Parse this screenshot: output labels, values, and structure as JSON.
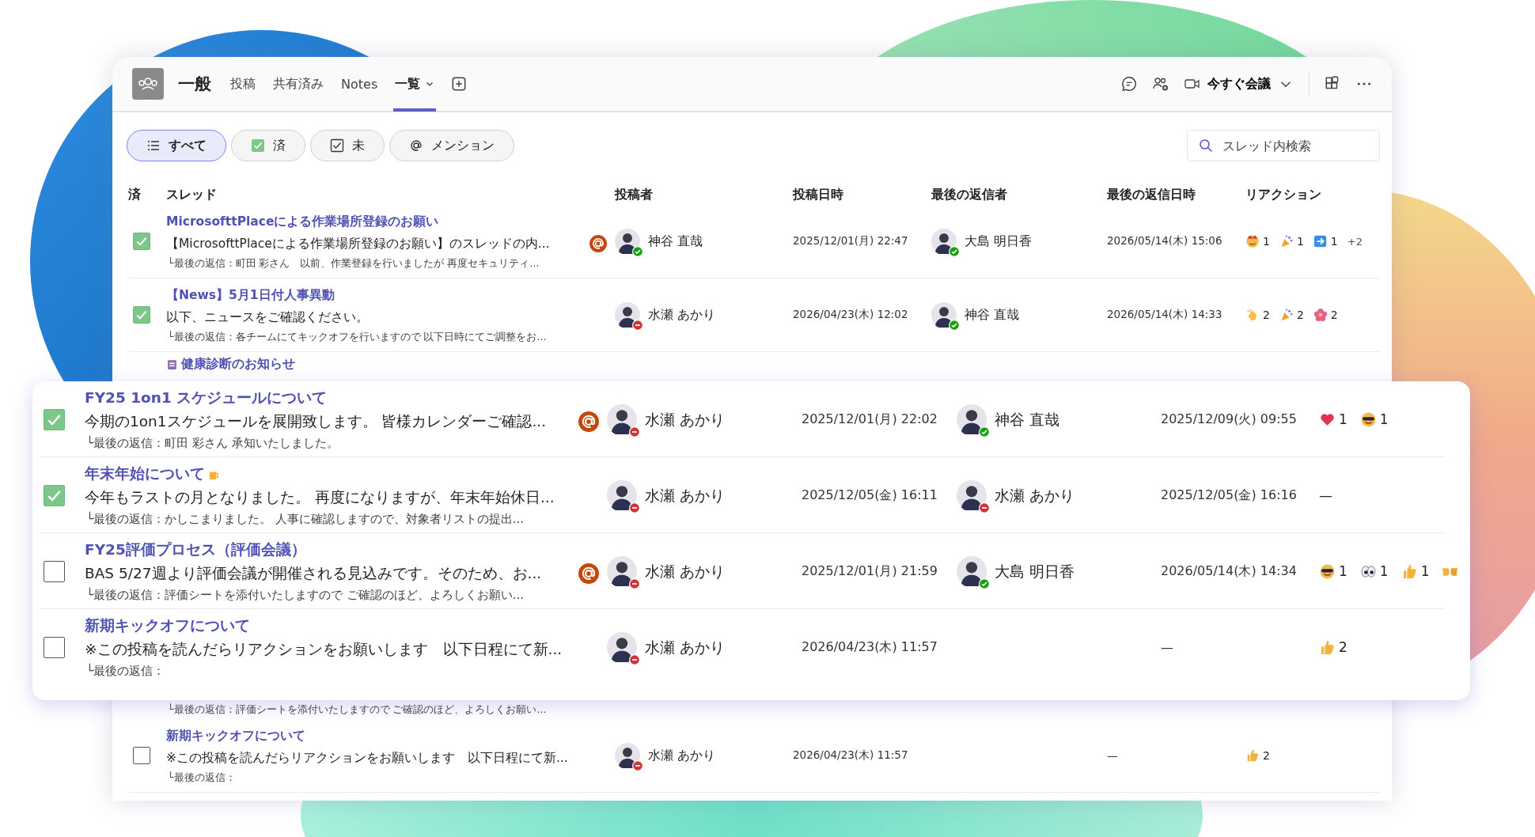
{
  "channel": {
    "name": "一般",
    "tabs": [
      {
        "label": "投稿",
        "selected": false,
        "dropdown": false
      },
      {
        "label": "共有済み",
        "selected": false,
        "dropdown": false
      },
      {
        "label": "Notes",
        "selected": false,
        "dropdown": false
      },
      {
        "label": "一覧",
        "selected": true,
        "dropdown": true
      }
    ]
  },
  "toolbar": {
    "meet_label": "今すぐ会議"
  },
  "filters": [
    {
      "kind": "all",
      "label": "すべて",
      "selected": true
    },
    {
      "kind": "done",
      "label": "済",
      "selected": false
    },
    {
      "kind": "todo",
      "label": "未",
      "selected": false
    },
    {
      "kind": "mention",
      "label": "メンション",
      "selected": false
    }
  ],
  "search": {
    "placeholder": "スレッド内検索"
  },
  "table": {
    "columns": [
      "済",
      "スレッド",
      "投稿者",
      "投稿日時",
      "最後の返信者",
      "最後の返信日時",
      "リアクション"
    ],
    "rows": [
      {
        "done": true,
        "title": "MicrosofttPlaceによる作業場所登録のお願い",
        "preview": "【MicrosofttPlaceによる作業場所登録のお願い】のスレッドの内...",
        "mention": true,
        "reply": "└最後の返信：町田 彩さん　以前、作業登録を行いましたが 再度セキュリティ...",
        "poster": {
          "name": "神谷 直哉",
          "online": true
        },
        "posted": "2025/12/01(月) 22:47",
        "last_replier": {
          "name": "大島 明日香",
          "online": true
        },
        "last_replied": "2026/05/14(木) 15:06",
        "reactions": [
          {
            "kind": "face",
            "count": "1"
          },
          {
            "kind": "party",
            "count": "1"
          },
          {
            "kind": "arrow",
            "count": "1"
          }
        ],
        "more": "+2"
      },
      {
        "done": true,
        "title": "【News】5月1日付人事異動",
        "preview": "以下、ニュースをご確認ください。",
        "mention": false,
        "reply": "└最後の返信：各チームにてキックオフを行いますので 以下日時にてご調整をお...",
        "poster": {
          "name": "水瀬 あかり",
          "online": false
        },
        "posted": "2026/04/23(木) 12:02",
        "last_replier": {
          "name": "神谷 直哉",
          "online": true
        },
        "last_replied": "2026/05/14(木) 14:33",
        "reactions": [
          {
            "kind": "clap",
            "count": "2"
          },
          {
            "kind": "party",
            "count": "2"
          },
          {
            "kind": "flower",
            "count": "2"
          }
        ]
      },
      {
        "title": "健康診断のお知らせ",
        "title_icon": {
          "kind": "clipboard"
        }
      },
      {
        "reply": "└最後の返信：評価シートを添付いたしますので ご確認のほど、よろしくお願い..."
      },
      {
        "done": false,
        "title": "新期キックオフについて",
        "preview": "※この投稿を読んだらリアクションをお願いします　以下日程にて新...",
        "mention": false,
        "reply": "└最後の返信：",
        "poster": {
          "name": "水瀬 あかり",
          "online": false
        },
        "posted": "2026/04/23(木) 11:57",
        "last_replied": "—",
        "reactions": [
          {
            "kind": "thumbs",
            "count": "2"
          }
        ]
      }
    ]
  },
  "zoomed_card": {
    "rows": [
      {
        "done": true,
        "title": "FY25 1on1 スケジュールについて",
        "preview": "今期の1on1スケジュールを展開致します。 皆様カレンダーご確認...",
        "mention": true,
        "reply": "└最後の返信：町田 彩さん 承知いたしました。",
        "poster": {
          "name": "水瀬 あかり",
          "online": false
        },
        "posted": "2025/12/01(月) 22:02",
        "last_replier": {
          "name": "神谷 直哉",
          "online": true
        },
        "last_replied": "2025/12/09(火) 09:55",
        "reactions": [
          {
            "kind": "heart",
            "count": "1"
          },
          {
            "kind": "cool",
            "count": "1"
          }
        ]
      },
      {
        "done": true,
        "title": "年末年始について",
        "title_icon": {
          "kind": "beer"
        },
        "preview": "今年もラストの月となりました。 再度になりますが、年末年始休日...",
        "mention": false,
        "reply": "└最後の返信：かしこまりました。 人事に確認しますので、対象者リストの提出...",
        "poster": {
          "name": "水瀬 あかり",
          "online": false
        },
        "posted": "2025/12/05(金) 16:11",
        "last_replier": {
          "name": "水瀬 あかり",
          "online": false
        },
        "last_replied": "2025/12/05(金) 16:16",
        "reaction_note": "—"
      },
      {
        "done": false,
        "title": "FY25評価プロセス（評価会議）",
        "preview": "BAS 5/27週より評価会議が開催される見込みです。そのため、お...",
        "mention": true,
        "reply": "└最後の返信：評価シートを添付いたしますので ご確認のほど、よろしくお願い...",
        "poster": {
          "name": "水瀬 あかり",
          "online": false
        },
        "posted": "2025/12/01(月) 21:59",
        "last_replier": {
          "name": "大島 明日香",
          "online": true
        },
        "last_replied": "2026/05/14(木) 14:34",
        "reactions": [
          {
            "kind": "cool",
            "count": "1"
          },
          {
            "kind": "eyes",
            "count": "1"
          },
          {
            "kind": "thumbs",
            "count": "1"
          },
          {
            "kind": "fist"
          }
        ]
      },
      {
        "done": false,
        "title": "新期キックオフについて",
        "preview": "※この投稿を読んだらリアクションをお願いします　以下日程にて新...",
        "mention": false,
        "reply": "└最後の返信：",
        "poster": {
          "name": "水瀬 あかり",
          "online": false
        },
        "posted": "2026/04/23(木) 11:57",
        "last_replied": "—",
        "reactions": [
          {
            "kind": "thumbs",
            "count": "2"
          }
        ]
      }
    ]
  }
}
